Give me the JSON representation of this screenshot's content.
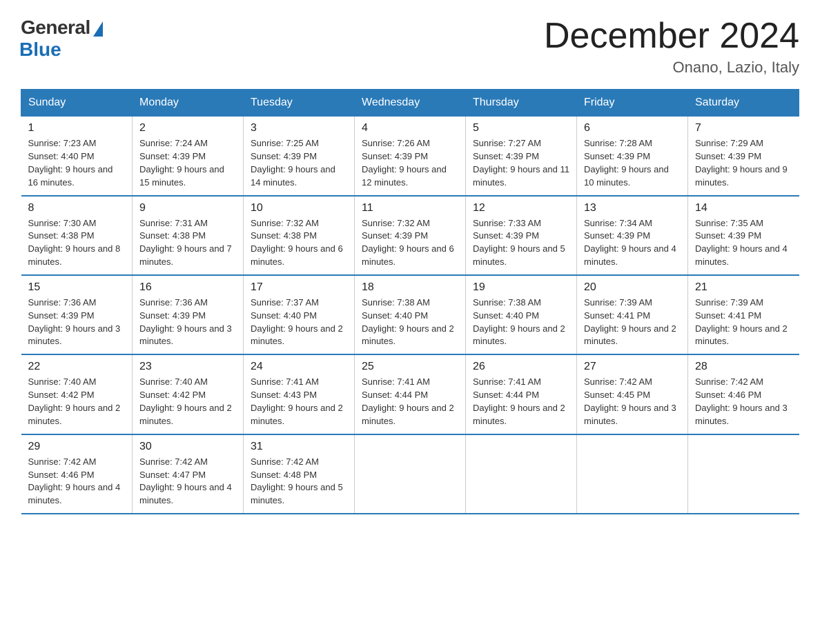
{
  "logo": {
    "general": "General",
    "blue": "Blue"
  },
  "header": {
    "title": "December 2024",
    "location": "Onano, Lazio, Italy"
  },
  "days": [
    "Sunday",
    "Monday",
    "Tuesday",
    "Wednesday",
    "Thursday",
    "Friday",
    "Saturday"
  ],
  "weeks": [
    [
      {
        "day": "1",
        "sunrise": "7:23 AM",
        "sunset": "4:40 PM",
        "daylight": "9 hours and 16 minutes."
      },
      {
        "day": "2",
        "sunrise": "7:24 AM",
        "sunset": "4:39 PM",
        "daylight": "9 hours and 15 minutes."
      },
      {
        "day": "3",
        "sunrise": "7:25 AM",
        "sunset": "4:39 PM",
        "daylight": "9 hours and 14 minutes."
      },
      {
        "day": "4",
        "sunrise": "7:26 AM",
        "sunset": "4:39 PM",
        "daylight": "9 hours and 12 minutes."
      },
      {
        "day": "5",
        "sunrise": "7:27 AM",
        "sunset": "4:39 PM",
        "daylight": "9 hours and 11 minutes."
      },
      {
        "day": "6",
        "sunrise": "7:28 AM",
        "sunset": "4:39 PM",
        "daylight": "9 hours and 10 minutes."
      },
      {
        "day": "7",
        "sunrise": "7:29 AM",
        "sunset": "4:39 PM",
        "daylight": "9 hours and 9 minutes."
      }
    ],
    [
      {
        "day": "8",
        "sunrise": "7:30 AM",
        "sunset": "4:38 PM",
        "daylight": "9 hours and 8 minutes."
      },
      {
        "day": "9",
        "sunrise": "7:31 AM",
        "sunset": "4:38 PM",
        "daylight": "9 hours and 7 minutes."
      },
      {
        "day": "10",
        "sunrise": "7:32 AM",
        "sunset": "4:38 PM",
        "daylight": "9 hours and 6 minutes."
      },
      {
        "day": "11",
        "sunrise": "7:32 AM",
        "sunset": "4:39 PM",
        "daylight": "9 hours and 6 minutes."
      },
      {
        "day": "12",
        "sunrise": "7:33 AM",
        "sunset": "4:39 PM",
        "daylight": "9 hours and 5 minutes."
      },
      {
        "day": "13",
        "sunrise": "7:34 AM",
        "sunset": "4:39 PM",
        "daylight": "9 hours and 4 minutes."
      },
      {
        "day": "14",
        "sunrise": "7:35 AM",
        "sunset": "4:39 PM",
        "daylight": "9 hours and 4 minutes."
      }
    ],
    [
      {
        "day": "15",
        "sunrise": "7:36 AM",
        "sunset": "4:39 PM",
        "daylight": "9 hours and 3 minutes."
      },
      {
        "day": "16",
        "sunrise": "7:36 AM",
        "sunset": "4:39 PM",
        "daylight": "9 hours and 3 minutes."
      },
      {
        "day": "17",
        "sunrise": "7:37 AM",
        "sunset": "4:40 PM",
        "daylight": "9 hours and 2 minutes."
      },
      {
        "day": "18",
        "sunrise": "7:38 AM",
        "sunset": "4:40 PM",
        "daylight": "9 hours and 2 minutes."
      },
      {
        "day": "19",
        "sunrise": "7:38 AM",
        "sunset": "4:40 PM",
        "daylight": "9 hours and 2 minutes."
      },
      {
        "day": "20",
        "sunrise": "7:39 AM",
        "sunset": "4:41 PM",
        "daylight": "9 hours and 2 minutes."
      },
      {
        "day": "21",
        "sunrise": "7:39 AM",
        "sunset": "4:41 PM",
        "daylight": "9 hours and 2 minutes."
      }
    ],
    [
      {
        "day": "22",
        "sunrise": "7:40 AM",
        "sunset": "4:42 PM",
        "daylight": "9 hours and 2 minutes."
      },
      {
        "day": "23",
        "sunrise": "7:40 AM",
        "sunset": "4:42 PM",
        "daylight": "9 hours and 2 minutes."
      },
      {
        "day": "24",
        "sunrise": "7:41 AM",
        "sunset": "4:43 PM",
        "daylight": "9 hours and 2 minutes."
      },
      {
        "day": "25",
        "sunrise": "7:41 AM",
        "sunset": "4:44 PM",
        "daylight": "9 hours and 2 minutes."
      },
      {
        "day": "26",
        "sunrise": "7:41 AM",
        "sunset": "4:44 PM",
        "daylight": "9 hours and 2 minutes."
      },
      {
        "day": "27",
        "sunrise": "7:42 AM",
        "sunset": "4:45 PM",
        "daylight": "9 hours and 3 minutes."
      },
      {
        "day": "28",
        "sunrise": "7:42 AM",
        "sunset": "4:46 PM",
        "daylight": "9 hours and 3 minutes."
      }
    ],
    [
      {
        "day": "29",
        "sunrise": "7:42 AM",
        "sunset": "4:46 PM",
        "daylight": "9 hours and 4 minutes."
      },
      {
        "day": "30",
        "sunrise": "7:42 AM",
        "sunset": "4:47 PM",
        "daylight": "9 hours and 4 minutes."
      },
      {
        "day": "31",
        "sunrise": "7:42 AM",
        "sunset": "4:48 PM",
        "daylight": "9 hours and 5 minutes."
      },
      null,
      null,
      null,
      null
    ]
  ]
}
